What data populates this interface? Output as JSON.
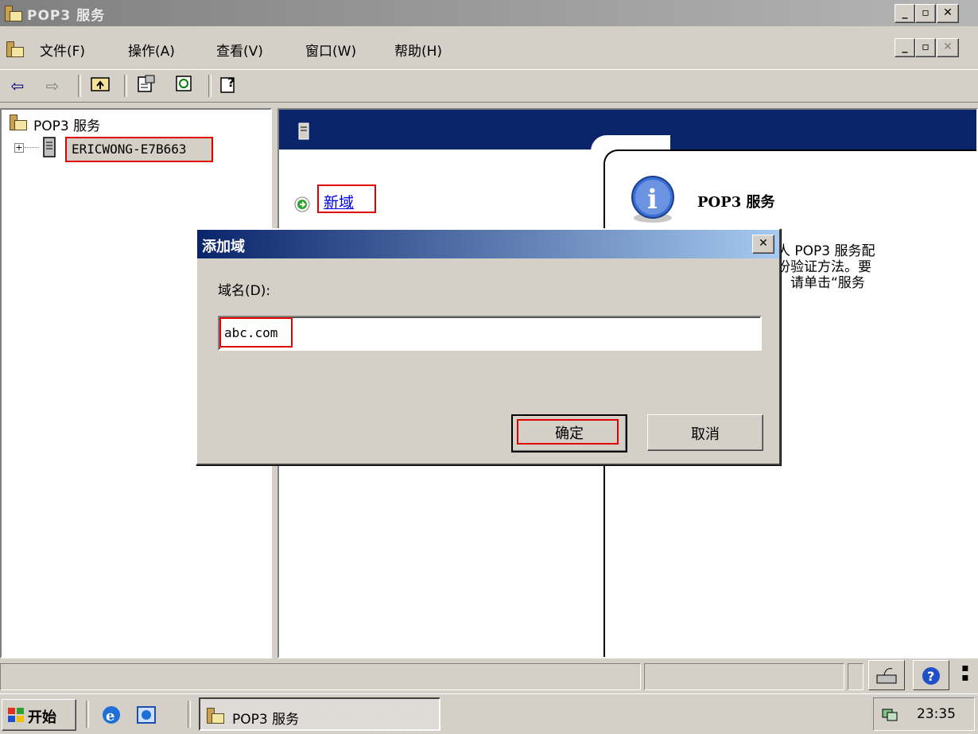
{
  "window": {
    "title": "POP3 服务"
  },
  "menu": [
    {
      "label": "文件(F)"
    },
    {
      "label": "操作(A)"
    },
    {
      "label": "查看(V)"
    },
    {
      "label": "窗口(W)"
    },
    {
      "label": "帮助(H)"
    }
  ],
  "toolbar": {
    "back_icon": "back-arrow-icon",
    "forward_icon": "forward-arrow-icon",
    "up_icon": "up-folder-icon",
    "properties_icon": "properties-icon",
    "refresh_icon": "refresh-icon",
    "help_icon": "help-icon"
  },
  "tree": {
    "root": "POP3 服务",
    "server": "ERICWONG-E7B663"
  },
  "right_pane": {
    "new_domain_link": "新域",
    "info_title": "POP3 服务",
    "info_lines": [
      "人 POP3 服务配",
      "份验证方法。要",
      "，请单击“服务"
    ]
  },
  "dialog": {
    "title": "添加域",
    "field_label": "域名(D):",
    "field_value": "abc.com",
    "ok_label": "确定",
    "cancel_label": "取消"
  },
  "taskbar": {
    "start_label": "开始",
    "task_label": "POP3 服务",
    "clock": "23:35"
  },
  "colors": {
    "title_blue": "#0a246a",
    "highlight_red": "#e00000",
    "link_blue": "#0000ee"
  }
}
